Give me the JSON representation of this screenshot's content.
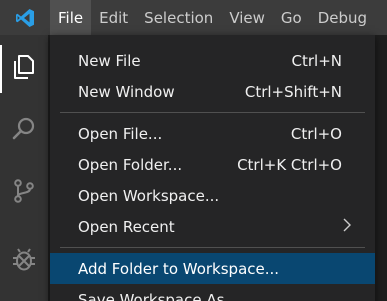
{
  "menubar": {
    "app_icon": "vscode-logo-icon",
    "items": [
      {
        "label": "File",
        "active": true
      },
      {
        "label": "Edit",
        "active": false
      },
      {
        "label": "Selection",
        "active": false
      },
      {
        "label": "View",
        "active": false
      },
      {
        "label": "Go",
        "active": false
      },
      {
        "label": "Debug",
        "active": false
      }
    ]
  },
  "activitybar": {
    "items": [
      {
        "icon": "explorer-files-icon",
        "active": true
      },
      {
        "icon": "search-icon",
        "active": false
      },
      {
        "icon": "source-control-icon",
        "active": false
      },
      {
        "icon": "debug-bug-icon",
        "active": false
      }
    ]
  },
  "file_menu": {
    "groups": [
      [
        {
          "label": "New File",
          "shortcut": "Ctrl+N"
        },
        {
          "label": "New Window",
          "shortcut": "Ctrl+Shift+N"
        }
      ],
      [
        {
          "label": "Open File...",
          "shortcut": "Ctrl+O"
        },
        {
          "label": "Open Folder...",
          "shortcut": "Ctrl+K Ctrl+O"
        },
        {
          "label": "Open Workspace...",
          "shortcut": ""
        },
        {
          "label": "Open Recent",
          "shortcut": "",
          "submenu": true
        }
      ],
      [
        {
          "label": "Add Folder to Workspace...",
          "shortcut": "",
          "selected": true
        },
        {
          "label": "Save Workspace As...",
          "shortcut": ""
        }
      ]
    ]
  },
  "colors": {
    "menubar_bg": "#3c3c3c",
    "activitybar_bg": "#333333",
    "menu_bg": "#252526",
    "selection_bg": "#094771",
    "vscode_blue": "#0078d4"
  }
}
